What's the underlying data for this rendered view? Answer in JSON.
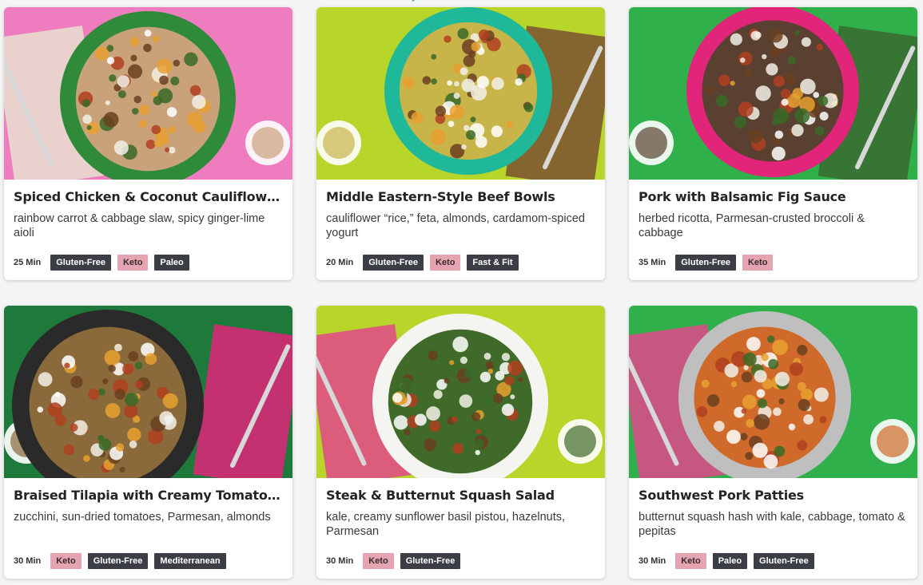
{
  "colors": {
    "tag_dark": "#3b3f45",
    "tag_pink": "#e4a4b1",
    "accent_green": "#2fae5b"
  },
  "recipes": [
    {
      "title": "Spiced Chicken & Coconut Cauliflower Rice",
      "description": "rainbow carrot & cabbage slaw, spicy ginger-lime aioli",
      "time": "25 Min",
      "tags": [
        {
          "label": "Gluten-Free",
          "style": "dark"
        },
        {
          "label": "Keto",
          "style": "pink"
        },
        {
          "label": "Paleo",
          "style": "dark"
        }
      ],
      "photo": {
        "bg": "#f07cc0",
        "plate": "#2f8a3a",
        "food": "#c9a27a",
        "accent": "#e8e0d0"
      }
    },
    {
      "title": "Middle Eastern-Style Beef Bowls",
      "description": "cauliflower “rice,” feta, almonds, cardamom-spiced yogurt",
      "time": "20 Min",
      "tags": [
        {
          "label": "Gluten-Free",
          "style": "dark"
        },
        {
          "label": "Keto",
          "style": "pink"
        },
        {
          "label": "Fast & Fit",
          "style": "dark"
        }
      ],
      "photo": {
        "bg": "#b8d62a",
        "plate": "#1fb99a",
        "food": "#c8b54a",
        "accent": "#7a5030"
      }
    },
    {
      "title": "Pork with Balsamic Fig Sauce",
      "description": "herbed ricotta, Parmesan-crusted broccoli & cabbage",
      "time": "35 Min",
      "tags": [
        {
          "label": "Gluten-Free",
          "style": "dark"
        },
        {
          "label": "Keto",
          "style": "pink"
        }
      ],
      "photo": {
        "bg": "#2fb04a",
        "plate": "#e0257a",
        "food": "#5a4030",
        "accent": "#3a6a30"
      }
    },
    {
      "title": "Braised Tilapia with Creamy Tomato Sauce",
      "description": "zucchini, sun-dried tomatoes, Parmesan, almonds",
      "time": "30 Min",
      "tags": [
        {
          "label": "Keto",
          "style": "pink"
        },
        {
          "label": "Gluten-Free",
          "style": "dark"
        },
        {
          "label": "Mediterranean",
          "style": "dark"
        }
      ],
      "photo": {
        "bg": "#1e7a3a",
        "plate": "#2a2a2a",
        "food": "#8a6a3a",
        "accent": "#e0247a"
      }
    },
    {
      "title": "Steak & Butternut Squash Salad",
      "description": "kale, creamy sunflower basil pistou, hazelnuts, Parmesan",
      "time": "30 Min",
      "tags": [
        {
          "label": "Keto",
          "style": "pink"
        },
        {
          "label": "Gluten-Free",
          "style": "dark"
        }
      ],
      "photo": {
        "bg": "#b8d62a",
        "plate": "#f4f4f0",
        "food": "#3f6a2a",
        "accent": "#e0488a"
      }
    },
    {
      "title": "Southwest Pork Patties",
      "description": "butternut squash hash with kale, cabbage, tomato & pepitas",
      "time": "30 Min",
      "tags": [
        {
          "label": "Keto",
          "style": "pink"
        },
        {
          "label": "Paleo",
          "style": "dark"
        },
        {
          "label": "Gluten-Free",
          "style": "dark"
        }
      ],
      "photo": {
        "bg": "#2fb04a",
        "plate": "#bfbfbf",
        "food": "#d06a2a",
        "accent": "#e0488a"
      }
    }
  ]
}
